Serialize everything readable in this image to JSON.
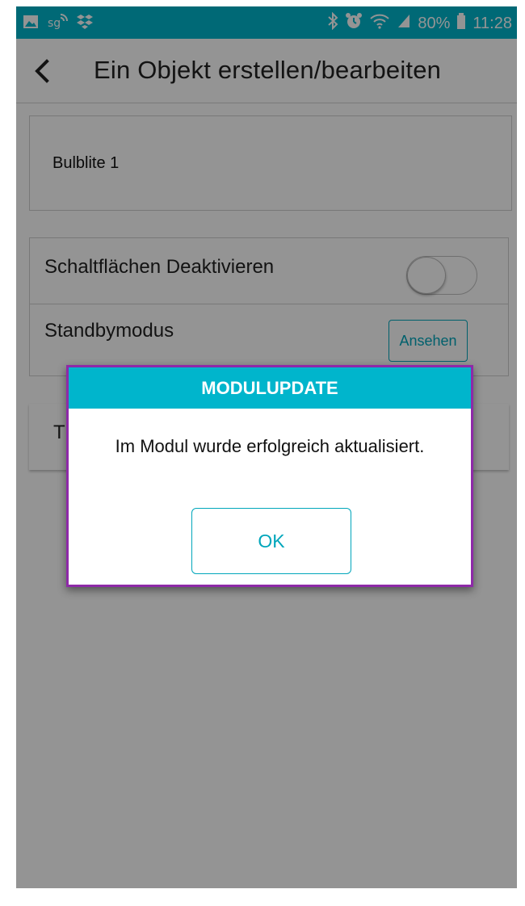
{
  "status_bar": {
    "left_icons": [
      "gallery-icon",
      "sg-signal-icon",
      "dropbox-icon"
    ],
    "right_icons": [
      "bluetooth-icon",
      "alarm-icon",
      "wifi-icon",
      "signal-icon",
      "battery-icon"
    ],
    "battery": "80%",
    "time": "11:28",
    "background": "#00b5cc"
  },
  "app_bar": {
    "title": "Ein Objekt erstellen/bearbeiten",
    "back_icon": "chevron-left-icon"
  },
  "name_field": {
    "value": "Bulblite 1"
  },
  "settings": {
    "disable_buttons_label": "Schaltflächen Deaktivieren",
    "disable_buttons_on": false,
    "standby_label": "Standbymodus",
    "standby_button": "Ansehen"
  },
  "hidden_row": {
    "visible_prefix": "T"
  },
  "dialog": {
    "title": "MODULUPDATE",
    "message": "Im Modul wurde erfolgreich aktualisiert.",
    "ok_label": "OK",
    "accent": "#00b5cc",
    "border": "#8e2aa8"
  }
}
